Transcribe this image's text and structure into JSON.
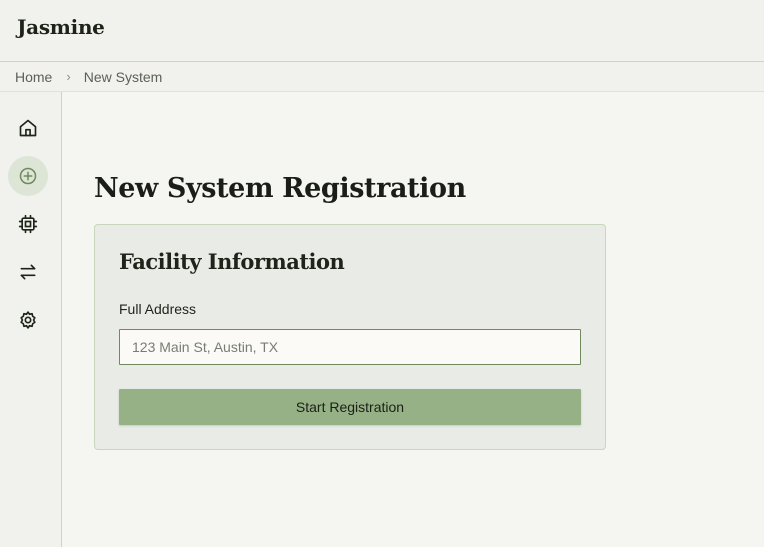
{
  "app": {
    "logo_text": "Jasmine"
  },
  "breadcrumb": {
    "items": [
      "Home",
      "New System"
    ],
    "separator": "›"
  },
  "sidebar": {
    "items": [
      {
        "icon": "home-icon",
        "active": false
      },
      {
        "icon": "plus-circle-icon",
        "active": true
      },
      {
        "icon": "chip-icon",
        "active": false
      },
      {
        "icon": "arrows-swap-icon",
        "active": false
      },
      {
        "icon": "gear-icon",
        "active": false
      }
    ]
  },
  "main": {
    "title": "New System Registration",
    "card": {
      "title": "Facility Information",
      "address_label": "Full Address",
      "address_placeholder": "123 Main St, Austin, TX",
      "address_value": "",
      "submit_label": "Start Registration"
    }
  },
  "colors": {
    "accent": "#97b187",
    "accent_border": "#6f8a5c",
    "active_nav_bg": "#dde5d6",
    "card_bg": "#e9ebe7"
  }
}
